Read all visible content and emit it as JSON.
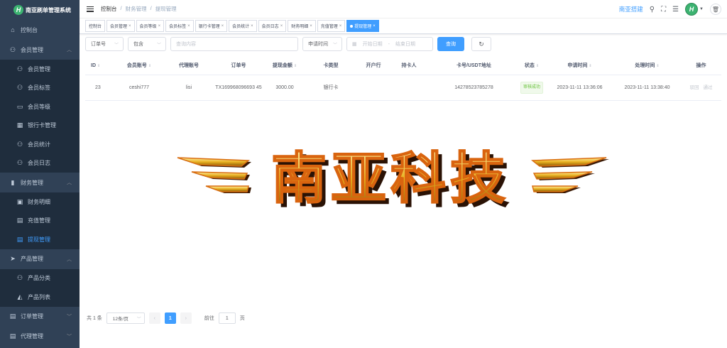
{
  "brand": {
    "logo_letter": "H",
    "title": "南亚刷单管理系统"
  },
  "sidebar": {
    "dashboard": "控制台",
    "member_group": "会员管理",
    "member_items": [
      {
        "label": "会员管理",
        "icon": "user-icon"
      },
      {
        "label": "会员标签",
        "icon": "user-icon"
      },
      {
        "label": "会员等级",
        "icon": "id-card-icon"
      },
      {
        "label": "银行卡管理",
        "icon": "bank-card-icon"
      },
      {
        "label": "会员统计",
        "icon": "user-icon"
      },
      {
        "label": "会员日志",
        "icon": "user-icon"
      }
    ],
    "finance_group": "财务管理",
    "finance_items": [
      {
        "label": "财务明细",
        "icon": "ledger-icon"
      },
      {
        "label": "充值管理",
        "icon": "deposit-icon"
      },
      {
        "label": "提现管理",
        "icon": "withdraw-icon"
      }
    ],
    "product_group": "产品管理",
    "product_items": [
      {
        "label": "产品分类",
        "icon": "user-icon"
      },
      {
        "label": "产品列表",
        "icon": "bag-icon"
      }
    ],
    "order_group": "订单管理",
    "agent_group": "代理管理"
  },
  "navbar": {
    "breadcrumb": [
      "控制台",
      "/",
      "财务管理",
      "/",
      "提现管理"
    ],
    "site_link": "南亚搭建",
    "avatar_letter": "H"
  },
  "tags": [
    {
      "label": "控制台",
      "closable": false
    },
    {
      "label": "会员管理",
      "closable": true
    },
    {
      "label": "会员等级",
      "closable": true
    },
    {
      "label": "会员标签",
      "closable": true
    },
    {
      "label": "银行卡管理",
      "closable": true
    },
    {
      "label": "会员统计",
      "closable": true
    },
    {
      "label": "会员日志",
      "closable": true
    },
    {
      "label": "财务明细",
      "closable": true
    },
    {
      "label": "充值管理",
      "closable": true
    },
    {
      "label": "提现管理",
      "closable": true,
      "active": true
    }
  ],
  "search": {
    "field_select": "订单号",
    "match_select": "包含",
    "query_placeholder": "查询内容",
    "time_select": "申请时间",
    "start_placeholder": "开始日期",
    "range_sep": "-",
    "end_placeholder": "结束日期",
    "query_button": "查询"
  },
  "table": {
    "headers": [
      "ID",
      "会员账号",
      "代理账号",
      "订单号",
      "提现金额",
      "卡类型",
      "开户行",
      "持卡人",
      "卡号/USDT地址",
      "状态",
      "申请时间",
      "处理时间",
      "操作"
    ],
    "rows": [
      {
        "id": "23",
        "account": "ceshi777",
        "agent": "lisi",
        "order_no": "TX169968096693 45",
        "amount": "3000.00",
        "card_type": "银行卡",
        "bank": "",
        "holder": "",
        "card_no": "14278523785278",
        "status": "审核成功",
        "apply_time": "2023-11-11 13:36:06",
        "process_time": "2023-11-11 13:38:40",
        "actions": [
          "驳回",
          "通过"
        ]
      }
    ]
  },
  "watermark": {
    "text": "南亚科技"
  },
  "pagination": {
    "total": "共 1 条",
    "page_size": "12条/页",
    "current": "1",
    "goto_label": "前往",
    "goto_value": "1",
    "page_suffix": "页"
  },
  "colors": {
    "sidebar_bg": "#304156",
    "primary": "#409eff",
    "success": "#67c23a"
  }
}
